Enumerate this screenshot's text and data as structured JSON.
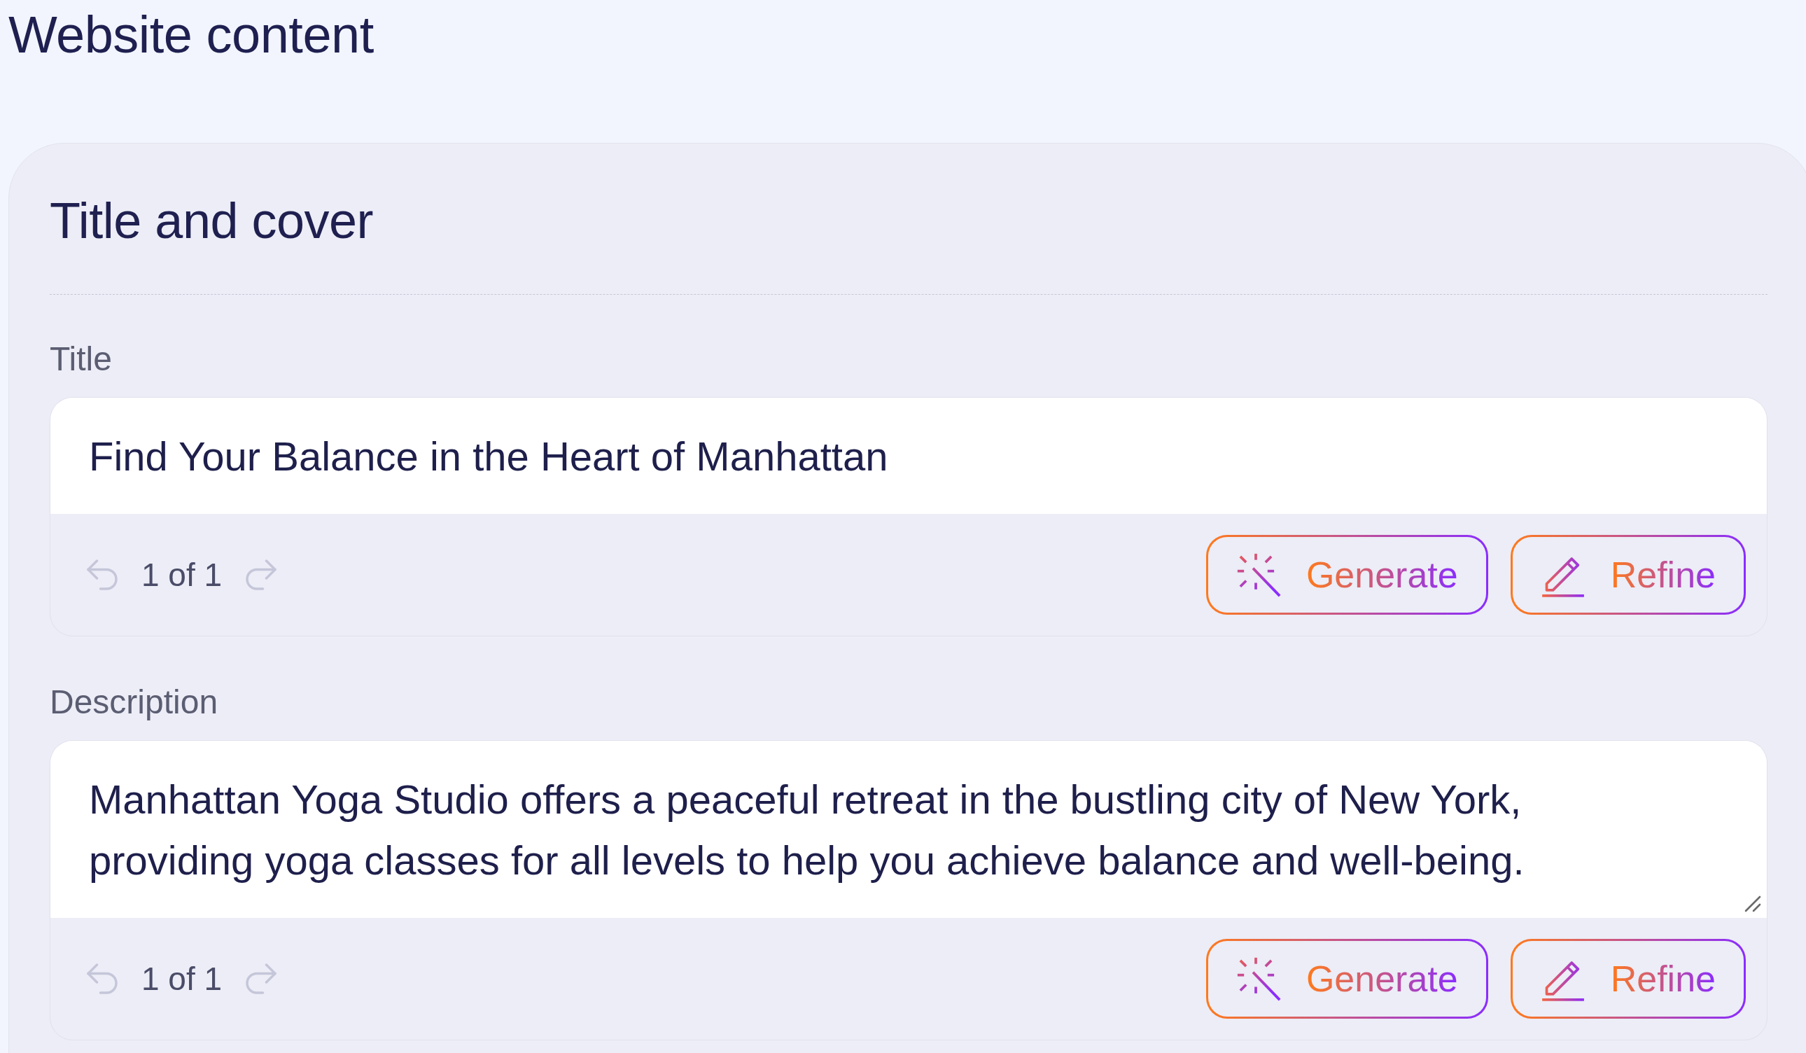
{
  "page_title": "Website content",
  "section": {
    "title": "Title and cover",
    "fields": [
      {
        "kind": "input",
        "label": "Title",
        "value": "Find Your Balance in the Heart of Manhattan",
        "history": {
          "counter": "1 of 1",
          "undo_disabled": true,
          "redo_disabled": true
        },
        "actions": [
          {
            "kind": "generate",
            "label": "Generate"
          },
          {
            "kind": "refine",
            "label": "Refine"
          }
        ]
      },
      {
        "kind": "textarea",
        "label": "Description",
        "value": "Manhattan Yoga Studio offers a peaceful retreat in the bustling city of New York, providing yoga classes for all levels to help you achieve balance and well-being.",
        "history": {
          "counter": "1 of 1",
          "undo_disabled": true,
          "redo_disabled": true
        },
        "actions": [
          {
            "kind": "generate",
            "label": "Generate"
          },
          {
            "kind": "refine",
            "label": "Refine"
          }
        ]
      }
    ]
  }
}
